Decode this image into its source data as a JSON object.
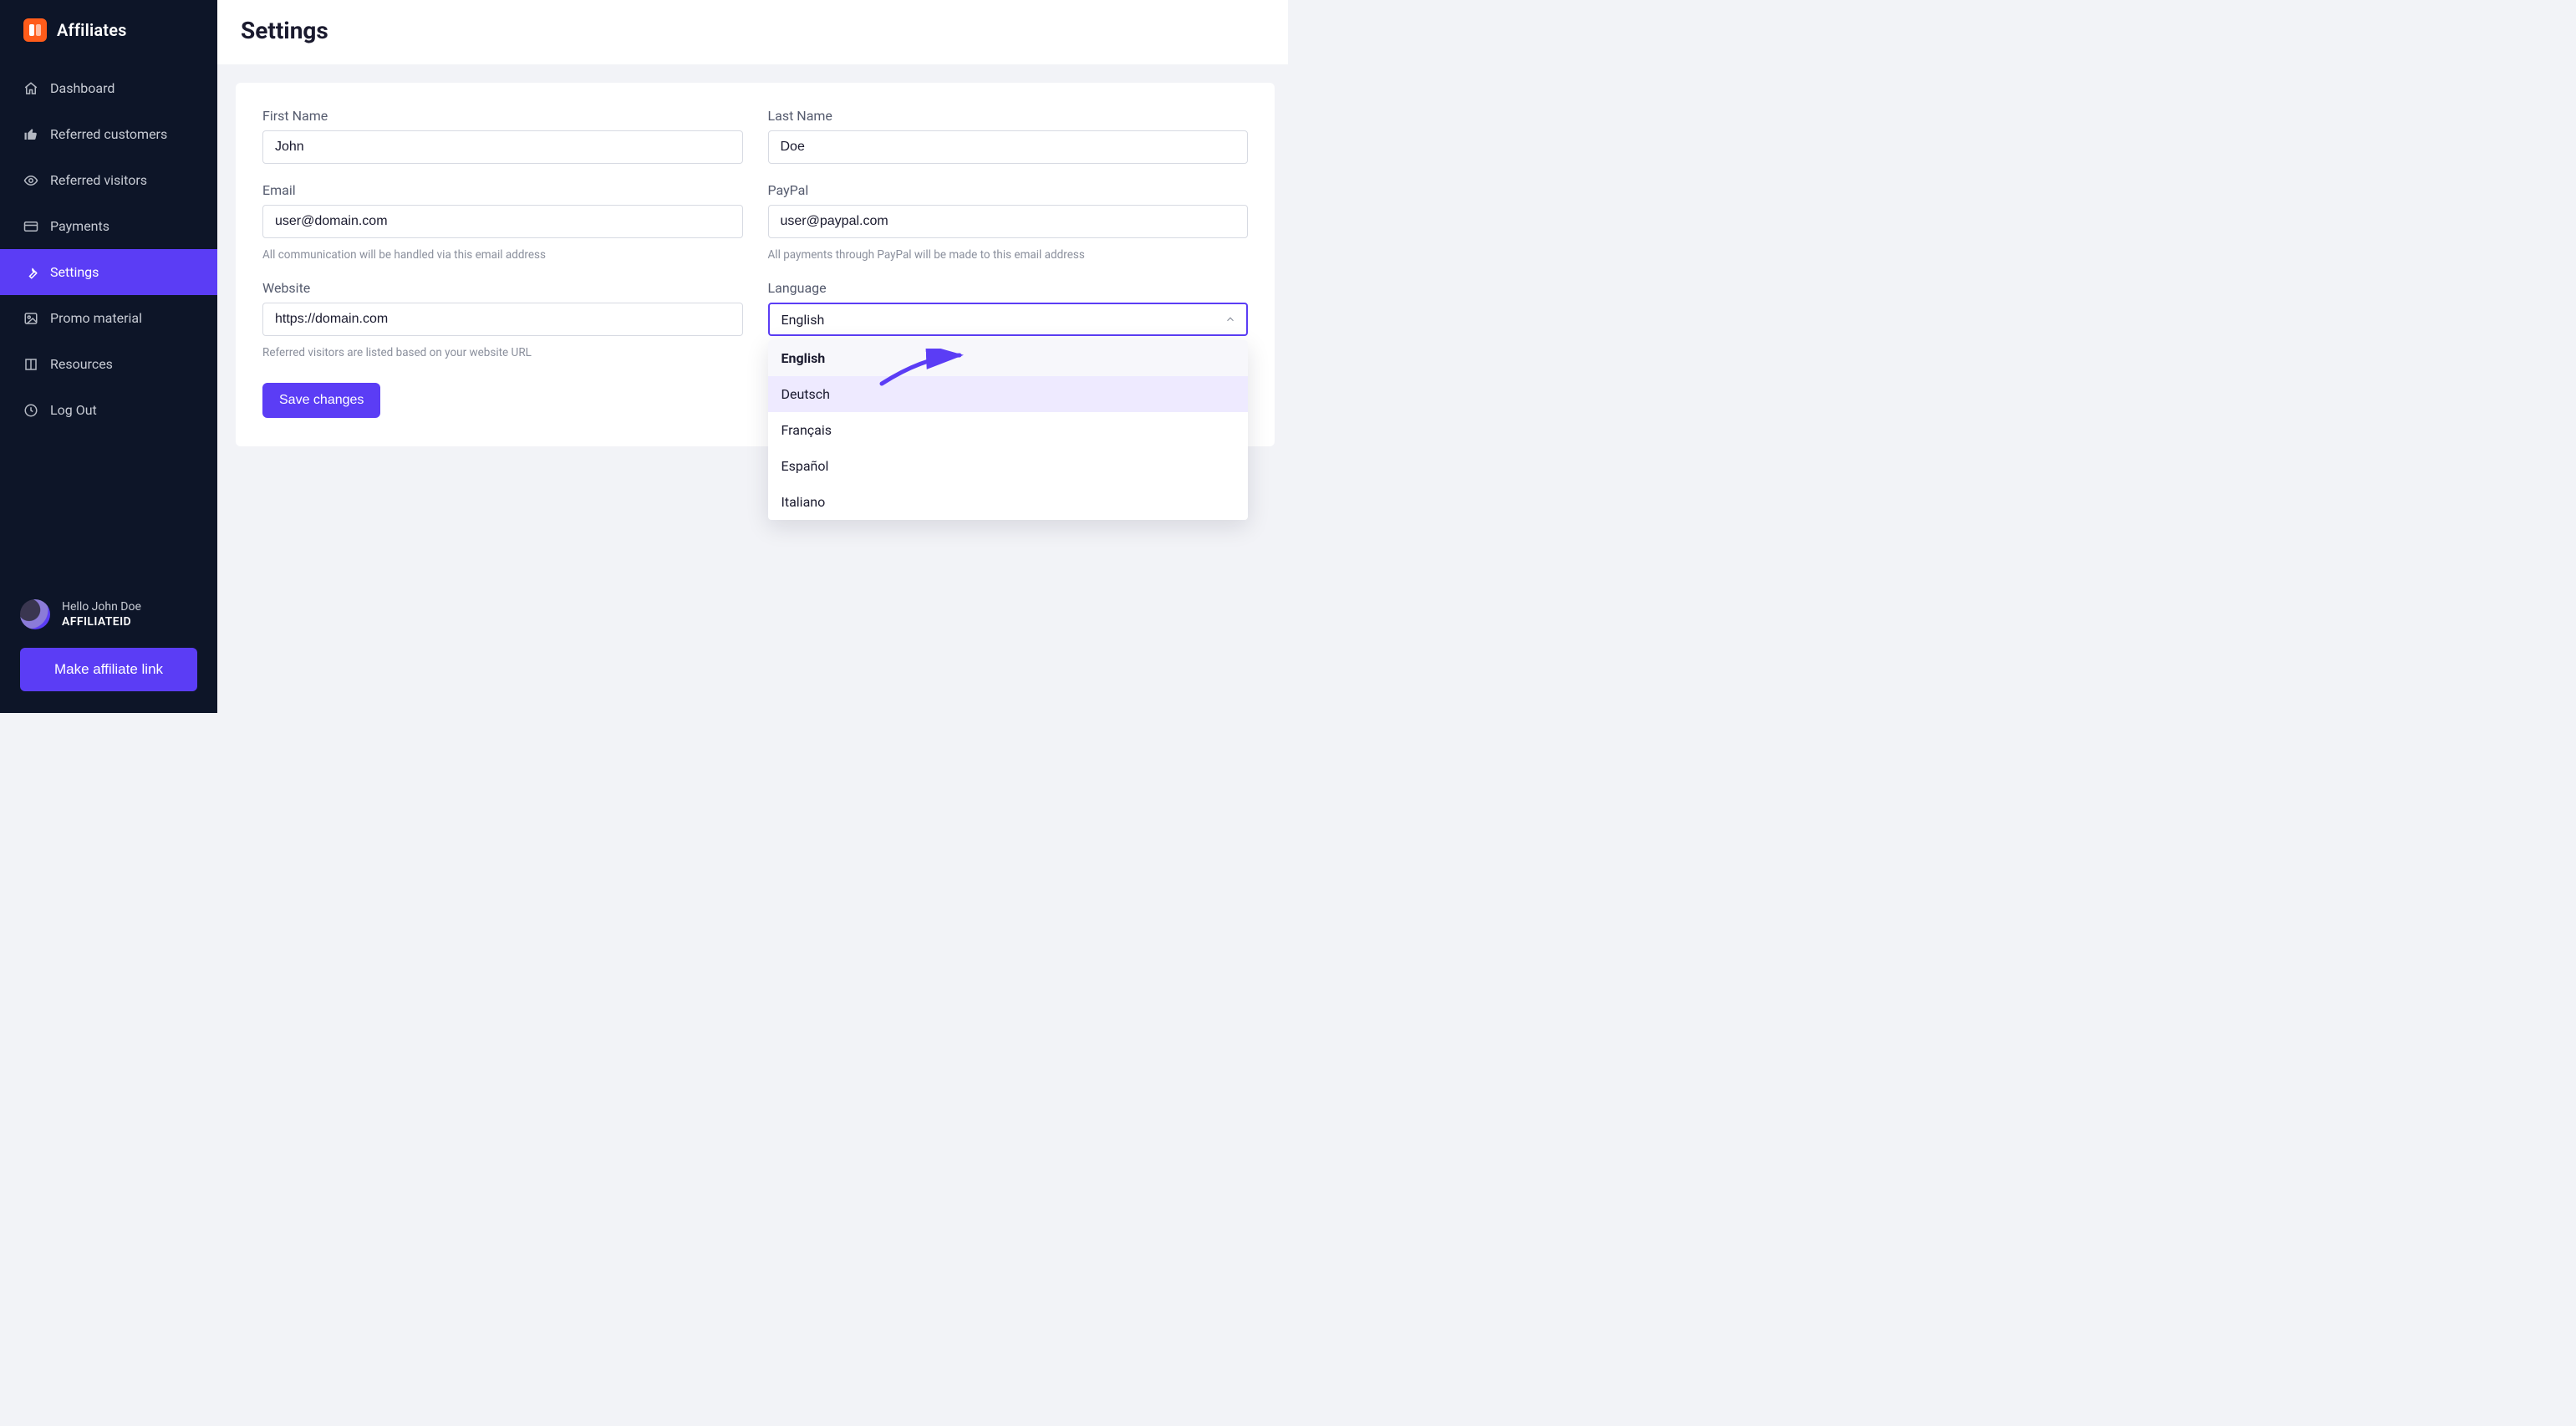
{
  "brand": {
    "name": "Affiliates"
  },
  "sidebar": {
    "items": [
      {
        "label": "Dashboard",
        "icon": "home-icon"
      },
      {
        "label": "Referred customers",
        "icon": "thumbs-up-icon"
      },
      {
        "label": "Referred visitors",
        "icon": "eye-icon"
      },
      {
        "label": "Payments",
        "icon": "card-icon"
      },
      {
        "label": "Settings",
        "icon": "wrench-icon",
        "active": true
      },
      {
        "label": "Promo material",
        "icon": "image-icon"
      },
      {
        "label": "Resources",
        "icon": "book-icon"
      },
      {
        "label": "Log Out",
        "icon": "logout-icon"
      }
    ],
    "user": {
      "hello": "Hello John Doe",
      "affiliate_id": "AFFILIATEID"
    },
    "make_link_label": "Make affiliate link"
  },
  "header": {
    "title": "Settings"
  },
  "form": {
    "first_name": {
      "label": "First Name",
      "value": "John"
    },
    "last_name": {
      "label": "Last Name",
      "value": "Doe"
    },
    "email": {
      "label": "Email",
      "value": "user@domain.com",
      "helper": "All communication will be handled via this email address"
    },
    "paypal": {
      "label": "PayPal",
      "value": "user@paypal.com",
      "helper": "All payments through PayPal will be made to this email address"
    },
    "website": {
      "label": "Website",
      "value": "https://domain.com",
      "helper": "Referred visitors are listed based on your website URL"
    },
    "language": {
      "label": "Language",
      "selected": "English",
      "options": [
        "English",
        "Deutsch",
        "Français",
        "Español",
        "Italiano"
      ],
      "hover_index": 1
    },
    "save_label": "Save changes"
  }
}
